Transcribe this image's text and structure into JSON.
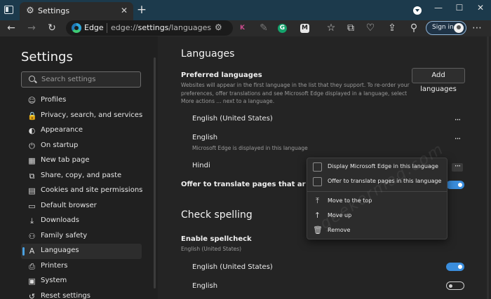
{
  "window": {
    "tab_title": "Settings",
    "tab_close_glyph": "✕",
    "new_tab_glyph": "+",
    "controls": {
      "minimize": "—",
      "maximize": "☐",
      "close": "✕"
    }
  },
  "toolbar": {
    "address_brand": "Edge",
    "address_url_scheme": "edge://",
    "address_url_host": "settings",
    "address_url_path": "/languages",
    "back_glyph": "←",
    "forward_glyph": "→",
    "refresh_glyph": "↻",
    "extensions": [
      {
        "icon": "k-extension-icon",
        "letter": "K",
        "color": "#c74b8b",
        "bg": "transparent"
      },
      {
        "icon": "grammarly-icon",
        "letter": "G",
        "color": "#ffffff",
        "bg": "#15a36c"
      },
      {
        "icon": "m-extension-icon",
        "letter": "M",
        "color": "#202020",
        "bg": "#e8e8e8"
      }
    ],
    "sign_in_label": "Sign in"
  },
  "sidebar": {
    "title": "Settings",
    "search_placeholder": "Search settings",
    "items": [
      {
        "label": "Profiles",
        "icon": "profile-icon",
        "glyph": "☺"
      },
      {
        "label": "Privacy, search, and services",
        "icon": "lock-icon",
        "glyph": "🔒"
      },
      {
        "label": "Appearance",
        "icon": "appearance-icon",
        "glyph": "◐"
      },
      {
        "label": "On startup",
        "icon": "power-icon",
        "glyph": "⏻"
      },
      {
        "label": "New tab page",
        "icon": "new-tab-icon",
        "glyph": "▦"
      },
      {
        "label": "Share, copy, and paste",
        "icon": "share-icon",
        "glyph": "⧉"
      },
      {
        "label": "Cookies and site permissions",
        "icon": "cookies-icon",
        "glyph": "▤"
      },
      {
        "label": "Default browser",
        "icon": "browser-icon",
        "glyph": "▭"
      },
      {
        "label": "Downloads",
        "icon": "download-icon",
        "glyph": "⤓"
      },
      {
        "label": "Family safety",
        "icon": "family-icon",
        "glyph": "⚇"
      },
      {
        "label": "Languages",
        "icon": "languages-icon",
        "glyph": "A",
        "active": true
      },
      {
        "label": "Printers",
        "icon": "printer-icon",
        "glyph": "⎙"
      },
      {
        "label": "System",
        "icon": "system-icon",
        "glyph": "▣"
      },
      {
        "label": "Reset settings",
        "icon": "reset-icon",
        "glyph": "↺"
      }
    ],
    "accent": "#4aa0e0"
  },
  "main": {
    "heading": "Languages",
    "preferred_title": "Preferred languages",
    "preferred_desc": "Websites will appear in the first language in the list that they support. To re-order your preferences, offer translations and see Microsoft Edge displayed in a language, select More actions ... next to a language.",
    "add_button": "Add languages",
    "languages": [
      {
        "name": "English (United States)",
        "sub": ""
      },
      {
        "name": "English",
        "sub": "Microsoft Edge is displayed in this language"
      },
      {
        "name": "Hindi",
        "sub": ""
      }
    ],
    "more_glyph": "···",
    "offer_translate_label": "Offer to translate pages that aren't in a language you read",
    "offer_translate_on": true,
    "spell_heading": "Check spelling",
    "spell_enable_title": "Enable spellcheck",
    "spell_enable_sub": "English (United States)",
    "spell_languages": [
      {
        "name": "English (United States)",
        "on": true
      },
      {
        "name": "English",
        "on": false
      }
    ],
    "toggle_color": "#3a8ddc"
  },
  "context_menu": {
    "items": [
      {
        "label": "Display Microsoft Edge in this language",
        "kind": "checkbox",
        "icon": "checkbox-icon"
      },
      {
        "label": "Offer to translate pages in this language",
        "kind": "checkbox",
        "icon": "checkbox-icon"
      },
      {
        "label": "Move to the top",
        "kind": "action",
        "icon": "move-top-icon",
        "glyph": "⤒"
      },
      {
        "label": "Move up",
        "kind": "action",
        "icon": "move-up-icon",
        "glyph": "↑"
      },
      {
        "label": "Remove",
        "kind": "action",
        "icon": "trash-icon",
        "glyph": "🗑"
      }
    ]
  },
  "watermark": "geekermag.com"
}
